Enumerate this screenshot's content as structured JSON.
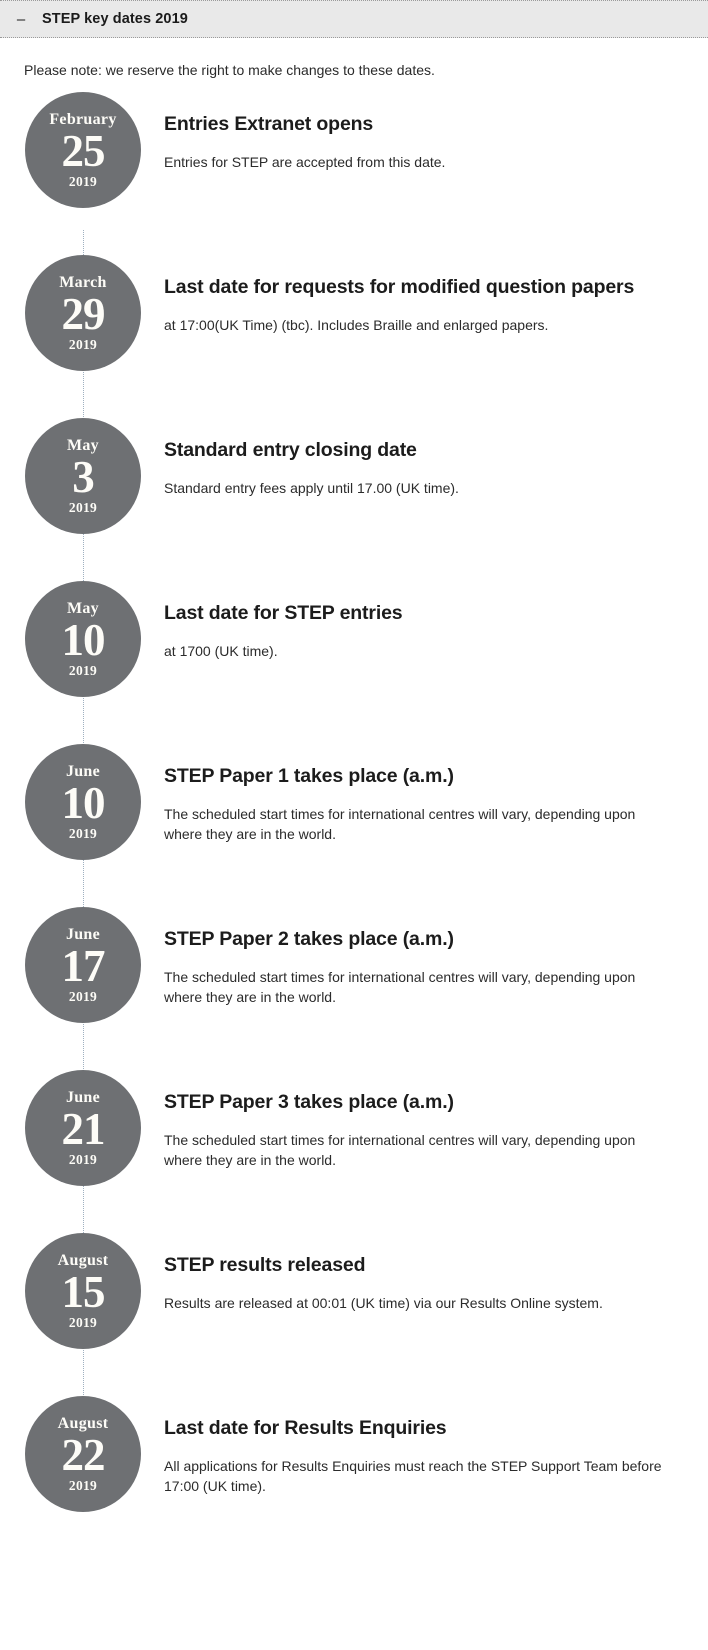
{
  "header": {
    "toggle_icon": "minus-icon",
    "toggle_glyph": "–",
    "title": "STEP key dates 2019"
  },
  "intro": {
    "note": "Please note: we reserve the right to make changes to these dates."
  },
  "theme": {
    "circle_color": "#6e7073",
    "circle_text_color": "#fdfcf7",
    "header_background": "#e9e9e9",
    "connector_color": "#9fb0c0",
    "title_color": "#1c1c1c",
    "body_color": "#2b2b2b"
  },
  "timeline": {
    "entries": [
      {
        "month": "February",
        "day": "25",
        "year": "2019",
        "title": "Entries Extranet opens",
        "description": "Entries for STEP are accepted from this date."
      },
      {
        "month": "March",
        "day": "29",
        "year": "2019",
        "title": "Last date for requests for modified question papers",
        "description": "at 17:00(UK Time) (tbc). Includes Braille and enlarged papers."
      },
      {
        "month": "May",
        "day": "3",
        "year": "2019",
        "title": "Standard entry closing date",
        "description": "Standard entry fees apply until 17.00 (UK time)."
      },
      {
        "month": "May",
        "day": "10",
        "year": "2019",
        "title": "Last date for STEP entries",
        "description": "at 1700 (UK time)."
      },
      {
        "month": "June",
        "day": "10",
        "year": "2019",
        "title": "STEP Paper 1 takes place (a.m.)",
        "description": "The scheduled start times for international centres will vary, depending upon where they are in the world."
      },
      {
        "month": "June",
        "day": "17",
        "year": "2019",
        "title": "STEP Paper 2 takes place (a.m.)",
        "description": "The scheduled start times for international centres will vary, depending upon where they are in the world."
      },
      {
        "month": "June",
        "day": "21",
        "year": "2019",
        "title": "STEP Paper 3 takes place (a.m.)",
        "description": "The scheduled start times for international centres will vary, depending upon where they are in the world."
      },
      {
        "month": "August",
        "day": "15",
        "year": "2019",
        "title": "STEP results released",
        "description": "Results are released at 00:01 (UK time) via our Results Online system."
      },
      {
        "month": "August",
        "day": "22",
        "year": "2019",
        "title": "Last date for Results Enquiries",
        "description": "All applications for Results Enquiries must reach the STEP Support Team before 17:00 (UK time)."
      }
    ]
  }
}
